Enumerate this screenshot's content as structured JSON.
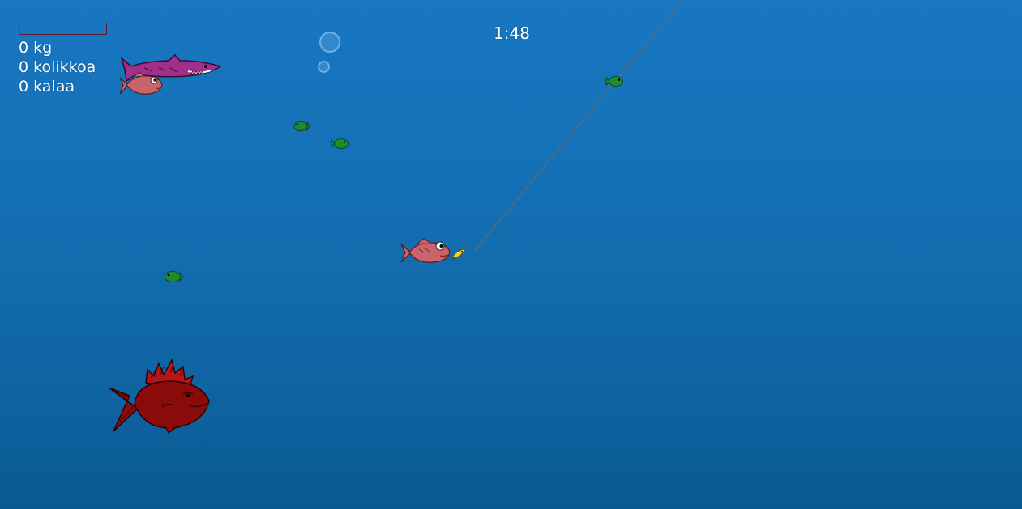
{
  "hud": {
    "weight": "0 kg",
    "coins": "0 kolikkoa",
    "fish": "0 kalaa",
    "catch_meter_fill": 0
  },
  "timer": "1:48",
  "colors": {
    "water_top": "#1877c2",
    "water_bottom": "#0a5a92",
    "small_fish": "#1f8a2f",
    "shark": "#a0308a",
    "pink_fish": "#c9646a",
    "red_fish": "#8b0a0a",
    "meter_border": "#c0243a",
    "lure": "#f2d22a",
    "fishing_line": "#5a6a7a"
  },
  "icons": {
    "small_fish": "green-fish-icon",
    "shark": "shark-icon",
    "pink_fish": "pink-fish-icon",
    "red_fish": "red-spiky-fish-icon",
    "lure": "lure-icon",
    "bubble": "bubble-icon"
  }
}
